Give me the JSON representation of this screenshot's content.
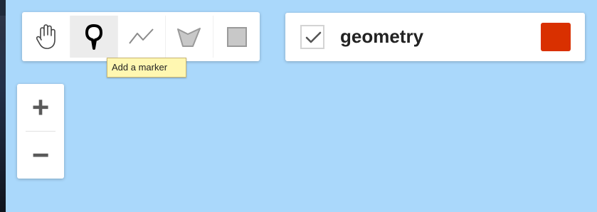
{
  "toolbar": {
    "tools": [
      {
        "id": "pan",
        "icon": "hand-icon",
        "active": false
      },
      {
        "id": "marker",
        "icon": "marker-pin-icon",
        "active": true
      },
      {
        "id": "line",
        "icon": "polyline-icon",
        "active": false
      },
      {
        "id": "polygon",
        "icon": "polygon-icon",
        "active": false
      },
      {
        "id": "rectangle",
        "icon": "rectangle-icon",
        "active": false
      }
    ]
  },
  "tooltip": {
    "text": "Add a marker"
  },
  "layer": {
    "name": "geometry",
    "checked": true,
    "color": "#d93000"
  },
  "zoom": {
    "in_label": "+",
    "out_label": "−"
  },
  "colors": {
    "map_background": "#aad8fb",
    "tooltip_background": "#fff7b1"
  }
}
